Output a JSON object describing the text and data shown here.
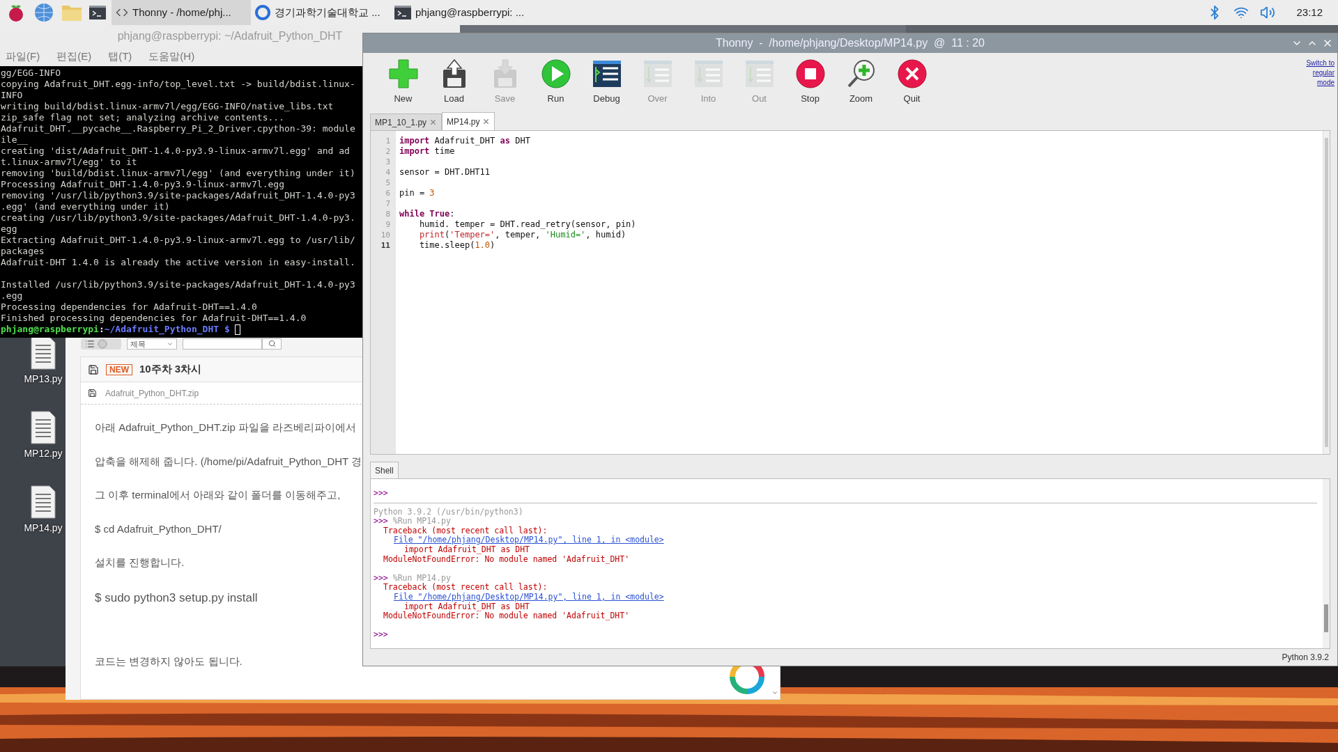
{
  "taskbar": {
    "tasks": [
      {
        "label": "Thonny  -  /home/phj...",
        "kind": "thonny",
        "selected": true
      },
      {
        "label": "경기과학기술대학교 ...",
        "kind": "browser",
        "selected": false
      },
      {
        "label": "phjang@raspberrypi: ...",
        "kind": "terminal",
        "selected": false
      }
    ],
    "clock": "23:12"
  },
  "desktop_icons": [
    {
      "label": "MP13.py"
    },
    {
      "label": "MP12.py"
    },
    {
      "label": "MP14.py"
    }
  ],
  "terminal": {
    "title": "phjang@raspberrypi: ~/Adafruit_Python_DHT",
    "menu": [
      "파일(F)",
      "편집(E)",
      "탭(T)",
      "도움말(H)"
    ],
    "lines": [
      "gg/EGG-INFO",
      "copying Adafruit_DHT.egg-info/top_level.txt -> build/bdist.linux-",
      "INFO",
      "writing build/bdist.linux-armv7l/egg/EGG-INFO/native_libs.txt",
      "zip_safe flag not set; analyzing archive contents...",
      "Adafruit_DHT.__pycache__.Raspberry_Pi_2_Driver.cpython-39: module",
      "ile__",
      "creating 'dist/Adafruit_DHT-1.4.0-py3.9-linux-armv7l.egg' and ad",
      "t.linux-armv7l/egg' to it",
      "removing 'build/bdist.linux-armv7l/egg' (and everything under it)",
      "Processing Adafruit_DHT-1.4.0-py3.9-linux-armv7l.egg",
      "removing '/usr/lib/python3.9/site-packages/Adafruit_DHT-1.4.0-py3",
      ".egg' (and everything under it)",
      "creating /usr/lib/python3.9/site-packages/Adafruit_DHT-1.4.0-py3.",
      "egg",
      "Extracting Adafruit_DHT-1.4.0-py3.9-linux-armv7l.egg to /usr/lib/",
      "packages",
      "Adafruit-DHT 1.4.0 is already the active version in easy-install.",
      {
        "kind": "blank"
      },
      "Installed /usr/lib/python3.9/site-packages/Adafruit_DHT-1.4.0-py3",
      ".egg",
      "Processing dependencies for Adafruit-DHT==1.4.0",
      "Finished processing dependencies for Adafruit-DHT==1.4.0"
    ],
    "prompt": {
      "user_host": "phjang@raspberrypi",
      "separator": ":",
      "path": "~/Adafruit_Python_DHT $"
    }
  },
  "browser": {
    "search_scope": "제목",
    "post": {
      "badge": "NEW",
      "title": "10주차 3차시",
      "attachment": "Adafruit_Python_DHT.zip",
      "paragraphs": [
        {
          "kind": "text",
          "text": "아래 Adafruit_Python_DHT.zip 파일을 라즈베리파이에서"
        },
        {
          "kind": "text",
          "text": "압축을 해제해 줍니다. (/home/pi/Adafruit_Python_DHT 경"
        },
        {
          "kind": "text",
          "text": "그 이후 terminal에서 아래와 같이 폴더를 이동해주고,"
        },
        {
          "kind": "text",
          "text": "$ cd Adafruit_Python_DHT/"
        },
        {
          "kind": "text",
          "text": "설치를 진행합니다."
        },
        {
          "kind": "command",
          "text": "$ sudo python3 setup.py install"
        },
        {
          "kind": "text",
          "text": "코드는 변경하지 않아도 됩니다."
        }
      ]
    }
  },
  "thonny": {
    "title": "Thonny  -  /home/phjang/Desktop/MP14.py  @  11 : 20",
    "toolbar": [
      {
        "label": "New",
        "kind": "new",
        "disabled": false
      },
      {
        "label": "Load",
        "kind": "load",
        "disabled": false
      },
      {
        "label": "Save",
        "kind": "save",
        "disabled": true
      },
      {
        "label": "Run",
        "kind": "run",
        "disabled": false
      },
      {
        "label": "Debug",
        "kind": "debug",
        "disabled": false
      },
      {
        "label": "Over",
        "kind": "over",
        "disabled": true
      },
      {
        "label": "Into",
        "kind": "into",
        "disabled": true
      },
      {
        "label": "Out",
        "kind": "out",
        "disabled": true
      },
      {
        "label": "Stop",
        "kind": "stop",
        "disabled": false
      },
      {
        "label": "Zoom",
        "kind": "zoom",
        "disabled": false
      },
      {
        "label": "Quit",
        "kind": "quit",
        "disabled": false
      }
    ],
    "mode_link": "Switch to regular mode",
    "tabs": [
      {
        "label": "MP1_10_1.py",
        "selected": false
      },
      {
        "label": "MP14.py",
        "selected": true
      }
    ],
    "editor": {
      "lines": [
        {
          "number": "1",
          "current": false,
          "tokens": [
            {
              "kind": "keyword",
              "text": "import"
            },
            {
              "kind": "plain",
              "text": " Adafruit_DHT "
            },
            {
              "kind": "keyword",
              "text": "as"
            },
            {
              "kind": "plain",
              "text": " DHT"
            }
          ]
        },
        {
          "number": "2",
          "current": false,
          "tokens": [
            {
              "kind": "keyword",
              "text": "import"
            },
            {
              "kind": "plain",
              "text": " time"
            }
          ]
        },
        {
          "number": "3",
          "current": false
        },
        {
          "number": "4",
          "current": false,
          "tokens": [
            {
              "kind": "plain",
              "text": "sensor = DHT.DHT11"
            }
          ]
        },
        {
          "number": "5",
          "current": false
        },
        {
          "number": "6",
          "current": false,
          "tokens": [
            {
              "kind": "plain",
              "text": "pin = "
            },
            {
              "kind": "number",
              "text": "3"
            }
          ]
        },
        {
          "number": "7",
          "current": false
        },
        {
          "number": "8",
          "current": false,
          "tokens": [
            {
              "kind": "keyword",
              "text": "while True"
            },
            {
              "kind": "plain",
              "text": ":"
            }
          ]
        },
        {
          "number": "9",
          "current": false,
          "tokens": [
            {
              "kind": "plain",
              "text": "    humid. temper = DHT.read_retry(sensor, pin)"
            }
          ]
        },
        {
          "number": "10",
          "current": false,
          "tokens": [
            {
              "kind": "builtin",
              "text": "    print"
            },
            {
              "kind": "plain",
              "text": "("
            },
            {
              "kind": "builtin",
              "text": "'Temper='"
            },
            {
              "kind": "plain",
              "text": ", temper, "
            },
            {
              "kind": "string",
              "text": "'Humid='"
            },
            {
              "kind": "plain",
              "text": ", humid)"
            }
          ]
        },
        {
          "number": "11",
          "current": true,
          "tokens": [
            {
              "kind": "plain",
              "text": "    time.sleep("
            },
            {
              "kind": "number",
              "text": "1.0"
            },
            {
              "kind": "plain",
              "text": ")"
            }
          ]
        }
      ]
    },
    "shell": {
      "tab": "Shell",
      "lines": [
        {
          "kind": "prompt",
          "prompt": ">>>"
        },
        {
          "kind": "separator"
        },
        {
          "kind": "info",
          "text": "Python 3.9.2 (/usr/bin/python3)"
        },
        {
          "kind": "command",
          "prompt": ">>>",
          "text": "%Run MP14.py"
        },
        {
          "kind": "error",
          "text": "Traceback (most recent call last):"
        },
        {
          "kind": "link",
          "text": "File \"/home/phjang/Desktop/MP14.py\", line 1, in <module>"
        },
        {
          "kind": "source",
          "text": "import Adafruit_DHT as DHT"
        },
        {
          "kind": "error",
          "text": "ModuleNotFoundError: No module named 'Adafruit_DHT'"
        },
        {
          "kind": "blank"
        },
        {
          "kind": "command",
          "prompt": ">>>",
          "text": "%Run MP14.py"
        },
        {
          "kind": "error",
          "text": "Traceback (most recent call last):"
        },
        {
          "kind": "link",
          "text": "File \"/home/phjang/Desktop/MP14.py\", line 1, in <module>"
        },
        {
          "kind": "source",
          "text": "import Adafruit_DHT as DHT"
        },
        {
          "kind": "error",
          "text": "ModuleNotFoundError: No module named 'Adafruit_DHT'"
        },
        {
          "kind": "blank"
        },
        {
          "kind": "prompt",
          "prompt": ">>>"
        }
      ]
    },
    "status": "Python 3.9.2"
  }
}
